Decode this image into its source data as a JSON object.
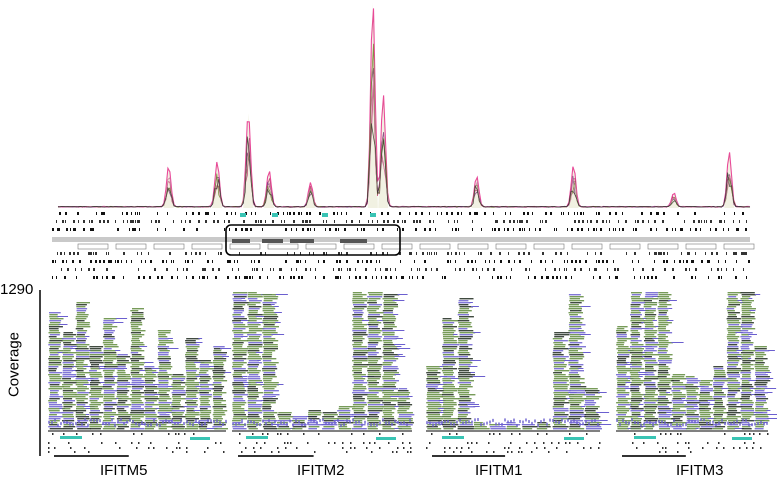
{
  "chart_data": {
    "type": "area",
    "y_axis_max_label": "1290",
    "ylabel": "Coverage",
    "ylim": [
      0,
      1290
    ],
    "overview": {
      "peaks": [
        {
          "pos": 0.16,
          "h": 0.2
        },
        {
          "pos": 0.23,
          "h": 0.22
        },
        {
          "pos": 0.275,
          "h": 0.46
        },
        {
          "pos": 0.305,
          "h": 0.18
        },
        {
          "pos": 0.365,
          "h": 0.12
        },
        {
          "pos": 0.455,
          "h": 1.0
        },
        {
          "pos": 0.47,
          "h": 0.55
        },
        {
          "pos": 0.605,
          "h": 0.15
        },
        {
          "pos": 0.745,
          "h": 0.2
        },
        {
          "pos": 0.89,
          "h": 0.07
        },
        {
          "pos": 0.97,
          "h": 0.27
        }
      ],
      "series_colors": [
        "#e8338f",
        "#c12777",
        "#7a2c8a",
        "#6a7a2a",
        "#d17ab0",
        "#2e2e2e"
      ]
    },
    "panels": [
      {
        "gene": "IFITM5",
        "coverage_profile": [
          0.85,
          0.7,
          0.92,
          0.6,
          0.8,
          0.55,
          0.88,
          0.45,
          0.72,
          0.4,
          0.66,
          0.5,
          0.6
        ]
      },
      {
        "gene": "IFITM2",
        "coverage_profile": [
          1.0,
          1.0,
          0.98,
          0.12,
          0.1,
          0.14,
          0.12,
          0.16,
          1.0,
          1.0,
          0.98,
          0.3
        ]
      },
      {
        "gene": "IFITM1",
        "coverage_profile": [
          0.45,
          0.8,
          0.95,
          0.05,
          0.04,
          0.05,
          0.04,
          0.05,
          0.7,
          0.98,
          0.3
        ]
      },
      {
        "gene": "IFITM3",
        "coverage_profile": [
          0.75,
          1.0,
          1.0,
          1.0,
          0.4,
          0.38,
          0.35,
          0.45,
          1.0,
          1.0,
          0.6
        ]
      }
    ]
  },
  "colors": {
    "read_green": "#5f8a3c",
    "read_blue": "#6b5fcf",
    "read_dark": "#1f2a1f",
    "exon_cyan": "#39c4b4",
    "highlight_box": "#000000"
  }
}
